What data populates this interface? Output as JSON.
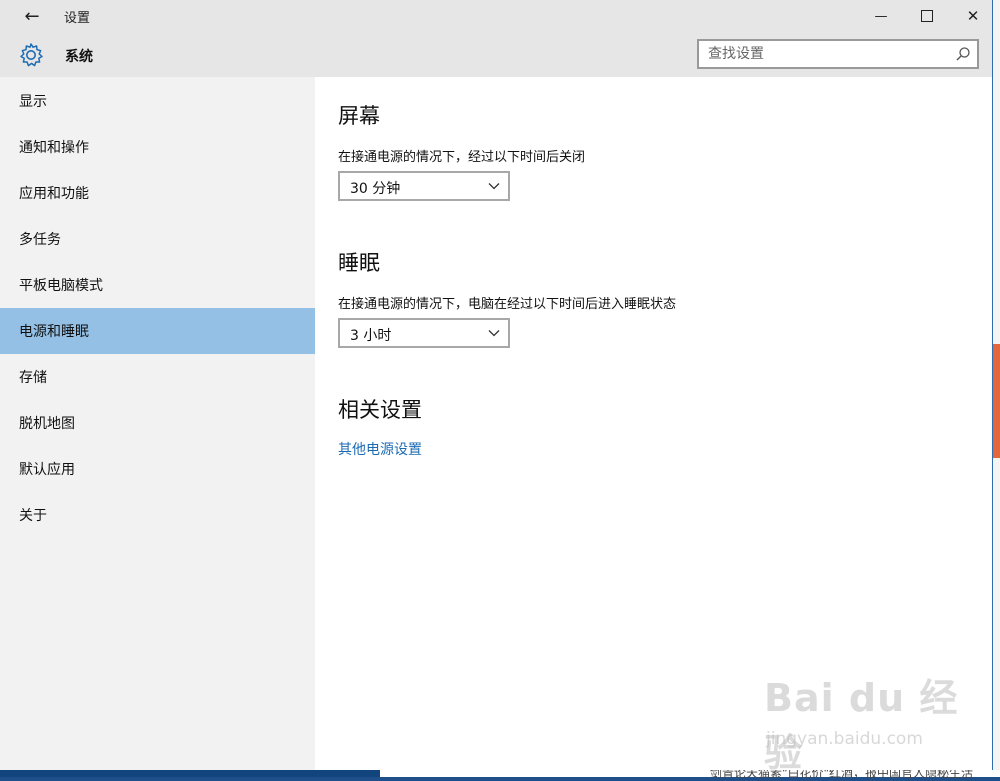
{
  "window": {
    "title": "设置",
    "back_label": "←",
    "min_label": "—",
    "close_label": "✕"
  },
  "header": {
    "title": "系统",
    "search_placeholder": "查找设置"
  },
  "sidebar": {
    "items": [
      {
        "label": "显示"
      },
      {
        "label": "通知和操作"
      },
      {
        "label": "应用和功能"
      },
      {
        "label": "多任务"
      },
      {
        "label": "平板电脑模式"
      },
      {
        "label": "电源和睡眠",
        "selected": true
      },
      {
        "label": "存储"
      },
      {
        "label": "脱机地图"
      },
      {
        "label": "默认应用"
      },
      {
        "label": "关于"
      }
    ]
  },
  "main": {
    "screen": {
      "heading": "屏幕",
      "description": "在接通电源的情况下，经过以下时间后关闭",
      "selected": "30 分钟"
    },
    "sleep": {
      "heading": "睡眠",
      "description": "在接通电源的情况下，电脑在经过以下时间后进入睡眠状态",
      "selected": "3 小时"
    },
    "related": {
      "heading": "相关设置",
      "link": "其他电源设置"
    }
  },
  "watermark": {
    "line1": "Bai du 经验",
    "line2": "jingyan.baidu.com"
  },
  "background_app": {
    "fragment_text": "剑青论天猫素\"白花价\"红酒，报中国官人隐秘生活"
  },
  "colors": {
    "selected_nav": "#94c0e6",
    "link": "#1d6bb3",
    "titlebar": "#e6e6e6",
    "sidebar": "#f2f2f2"
  }
}
